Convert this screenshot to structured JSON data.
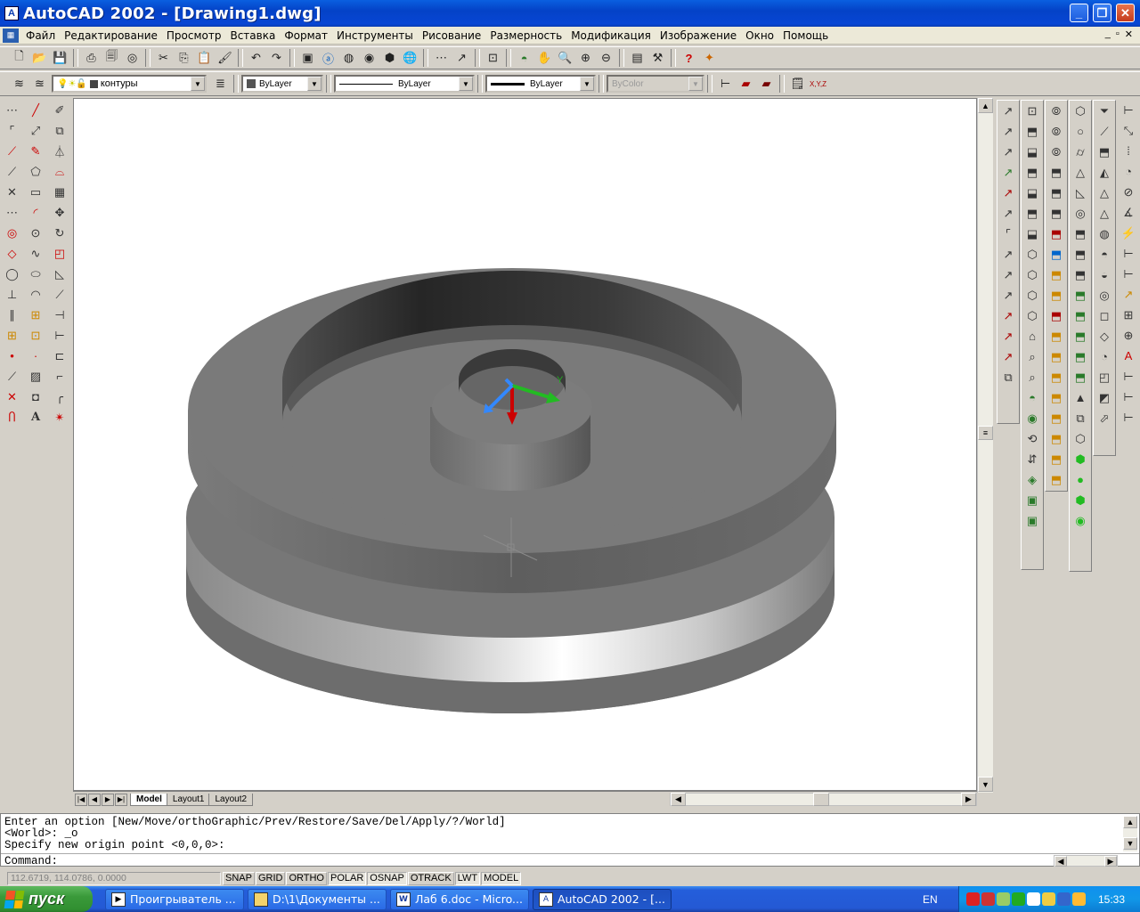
{
  "window": {
    "title": "AutoCAD 2002 - [Drawing1.dwg]",
    "app_icon": "A"
  },
  "menu": [
    "Файл",
    "Редактирование",
    "Просмотр",
    "Вставка",
    "Формат",
    "Инструменты",
    "Рисование",
    "Размерность",
    "Модификация",
    "Изображение",
    "Окно",
    "Помощь"
  ],
  "properties_bar": {
    "layer": "контуры",
    "color": "ByLayer",
    "linetype": "ByLayer",
    "lineweight": "ByLayer",
    "plotstyle": "ByColor"
  },
  "layout_tabs": {
    "model": "Model",
    "layout1": "Layout1",
    "layout2": "Layout2"
  },
  "command_history": [
    "Enter an option [New/Move/orthoGraphic/Prev/Restore/Save/Del/Apply/?/World]",
    "<World>: _o",
    "Specify new origin point <0,0,0>:"
  ],
  "command_prompt": "Command:",
  "status": {
    "coords": "112.6719, 114.0786, 0.0000",
    "buttons": [
      "SNAP",
      "GRID",
      "ORTHO",
      "POLAR",
      "OSNAP",
      "OTRACK",
      "LWT",
      "MODEL"
    ]
  },
  "ucs_icon": {
    "y_label": "Y"
  },
  "taskbar": {
    "start": "пуск",
    "items": [
      "Проигрыватель ...",
      "D:\\1\\Документы ...",
      "Лаб 6.doc - Micro...",
      "AutoCAD 2002 - [..."
    ],
    "lang": "EN",
    "time": "15:33"
  }
}
